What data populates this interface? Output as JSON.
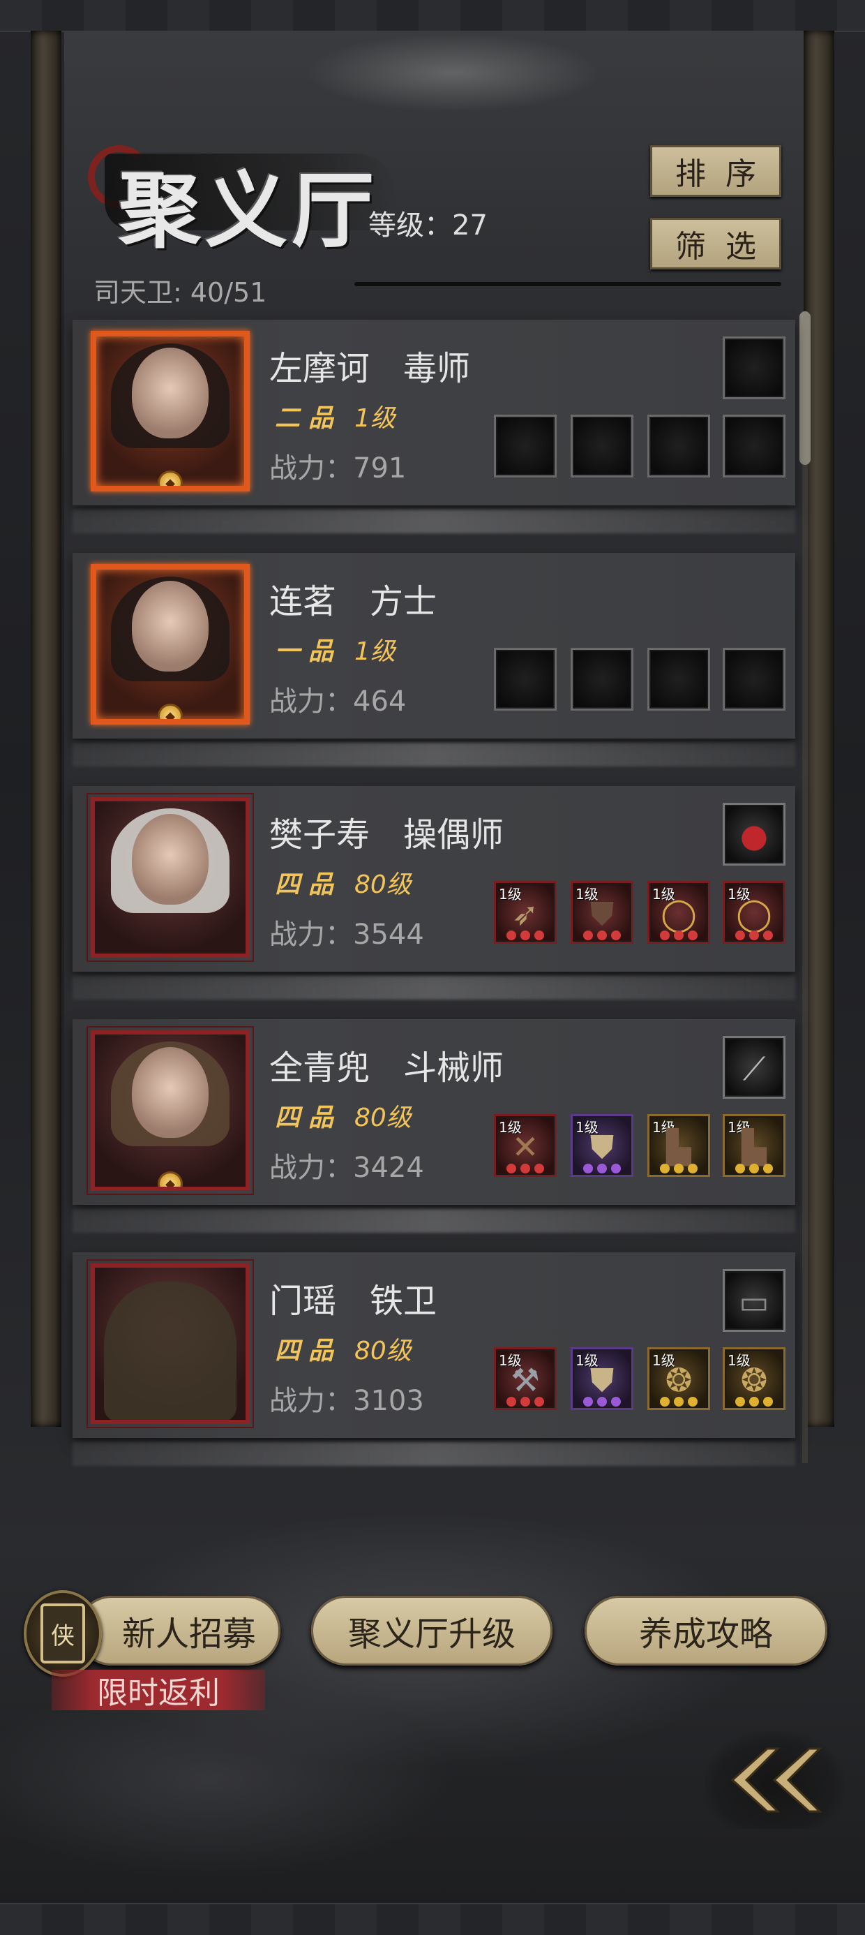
{
  "header": {
    "title": "聚义厅",
    "level_text": "等级：27",
    "capacity_text": "司天卫: 40/51",
    "sort_label": "排序",
    "filter_label": "筛选"
  },
  "heroes": [
    {
      "name": "左摩诃　毒师",
      "grade": "二品",
      "level": "1级",
      "power": "战力：791",
      "frame": "orange",
      "top_slot": null,
      "equipment": [
        null,
        null,
        null,
        null
      ]
    },
    {
      "name": "连茗　方士",
      "grade": "一品",
      "level": "1级",
      "power": "战力：464",
      "frame": "orange",
      "top_slot": null,
      "equipment": [
        null,
        null,
        null,
        null
      ]
    },
    {
      "name": "樊子寿　操偶师",
      "grade": "四品",
      "level": "80级",
      "power": "战力：3544",
      "frame": "red",
      "top_slot": "red-gem-icon",
      "equipment": [
        {
          "level": "1级",
          "icon": "arrow-bundle-icon",
          "quality": "red"
        },
        {
          "level": "1级",
          "icon": "armor-icon",
          "quality": "red"
        },
        {
          "level": "1级",
          "icon": "gold-ring-icon",
          "quality": "red"
        },
        {
          "level": "1级",
          "icon": "gold-ring-icon",
          "quality": "red"
        }
      ]
    },
    {
      "name": "全青兜　斗械师",
      "grade": "四品",
      "level": "80级",
      "power": "战力：3424",
      "frame": "red",
      "top_slot": "staff-icon",
      "equipment": [
        {
          "level": "1级",
          "icon": "crossbow-icon",
          "quality": "red"
        },
        {
          "level": "1级",
          "icon": "vest-icon",
          "quality": "purple"
        },
        {
          "level": "1级",
          "icon": "boots-icon",
          "quality": "gold"
        },
        {
          "level": "1级",
          "icon": "boots-icon",
          "quality": "gold"
        }
      ]
    },
    {
      "name": "门瑶　铁卫",
      "grade": "四品",
      "level": "80级",
      "power": "战力：3103",
      "frame": "red",
      "top_slot": "token-icon",
      "equipment": [
        {
          "level": "1级",
          "icon": "hammer-icon",
          "quality": "red"
        },
        {
          "level": "1级",
          "icon": "vest-icon",
          "quality": "purple"
        },
        {
          "level": "1级",
          "icon": "pouch-icon",
          "quality": "gold"
        },
        {
          "level": "1级",
          "icon": "pouch-icon",
          "quality": "gold"
        }
      ]
    }
  ],
  "footer": {
    "recruit_label": "新人招募",
    "upgrade_label": "聚义厅升级",
    "guide_label": "养成攻略",
    "promo_label": "限时返利",
    "emblem_glyph": "侠"
  },
  "colors": {
    "accent_gold": "#f2c45a",
    "button_beige": "#cdbf9c",
    "promo_red": "#9c2a2f",
    "frame_orange": "#e0581c",
    "frame_red": "#8c2224"
  }
}
